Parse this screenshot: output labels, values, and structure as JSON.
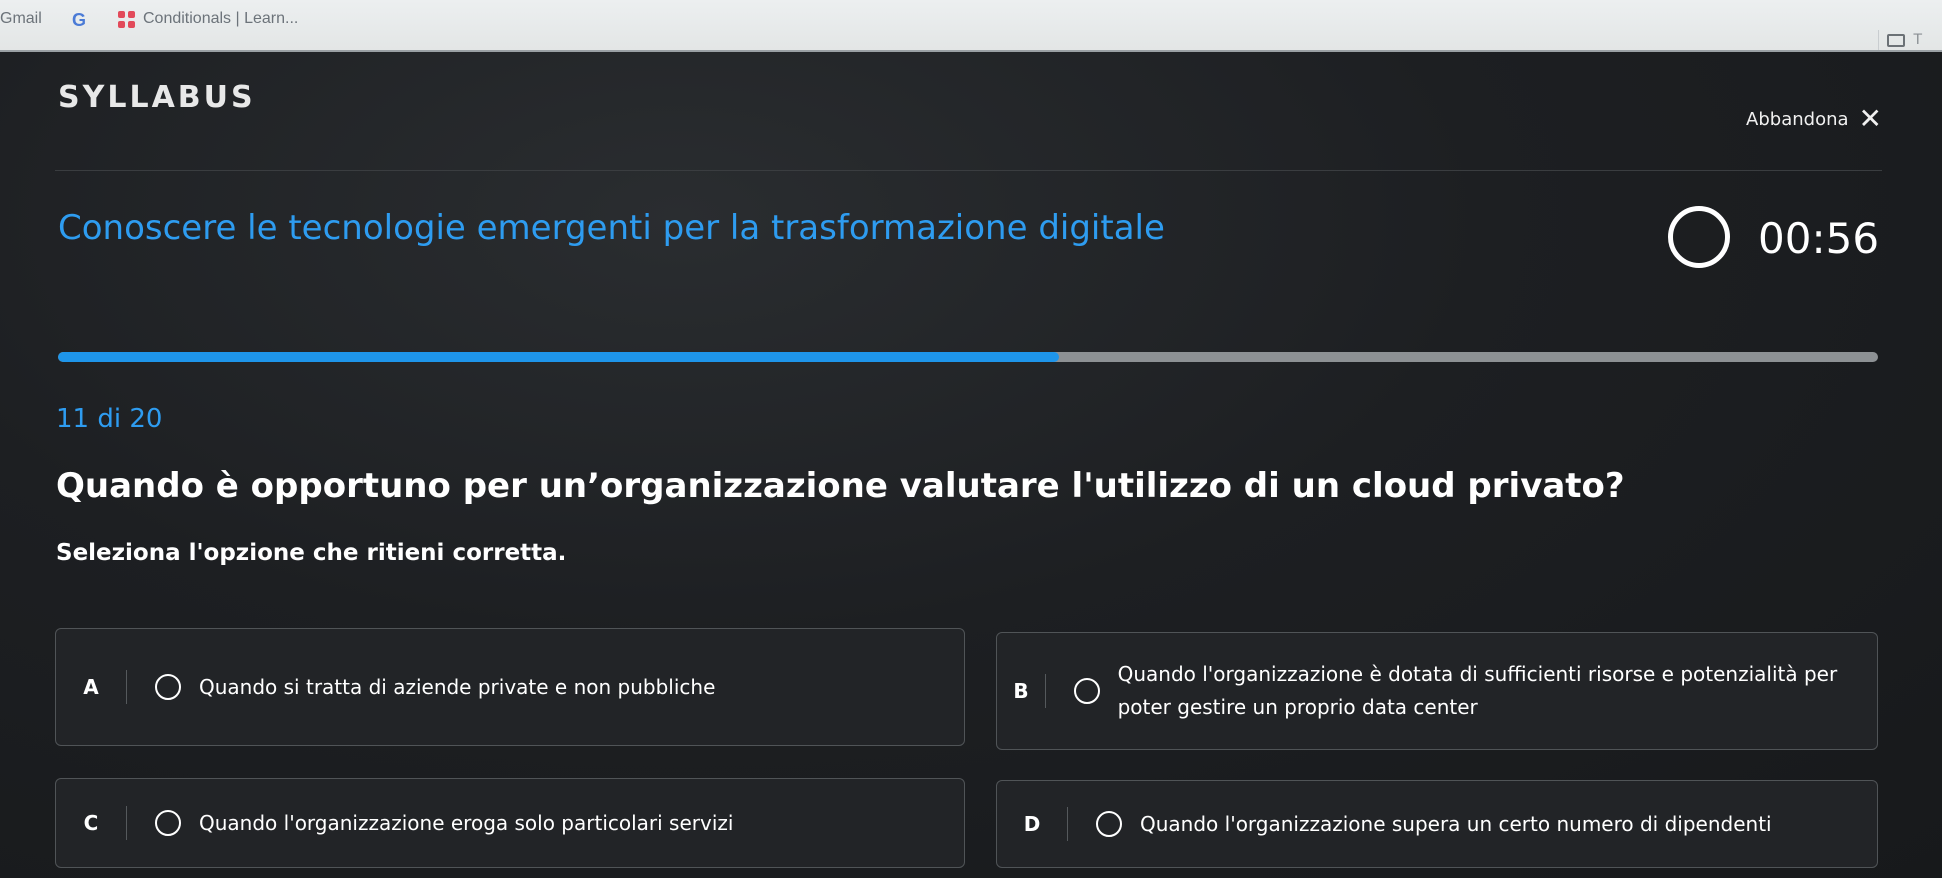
{
  "bookmarks": {
    "gmail": "Gmail",
    "google": "G",
    "tab_title": "Conditionals | Learn...",
    "right_letter": "T"
  },
  "header": {
    "logo": "SYLLABUS",
    "abandon_label": "Abbandona",
    "abandon_icon": "close-icon"
  },
  "course": {
    "title": "Conoscere le tecnologie emergenti per la trasformazione digitale"
  },
  "timer": {
    "value": "00:56"
  },
  "progress": {
    "current": 11,
    "total": 20,
    "fraction": 0.55,
    "label": "11 di 20"
  },
  "question": {
    "text": "Quando è opportuno per un’organizzazione valutare l'utilizzo di un cloud privato?",
    "instruction": "Seleziona l'opzione che ritieni corretta."
  },
  "options": [
    {
      "letter": "A",
      "text": "Quando si tratta di aziende private e non pubbliche"
    },
    {
      "letter": "B",
      "text": "Quando l'organizzazione è dotata di sufficienti risorse e potenzialità per poter gestire un proprio data center"
    },
    {
      "letter": "C",
      "text": "Quando l'organizzazione eroga solo particolari servizi"
    },
    {
      "letter": "D",
      "text": "Quando l'organizzazione supera un certo numero di dipendenti"
    }
  ],
  "colors": {
    "accent": "#2e9cf0",
    "progress_fill": "#1e95ea",
    "progress_track": "#8d9194",
    "background": "#1b1d1f"
  }
}
